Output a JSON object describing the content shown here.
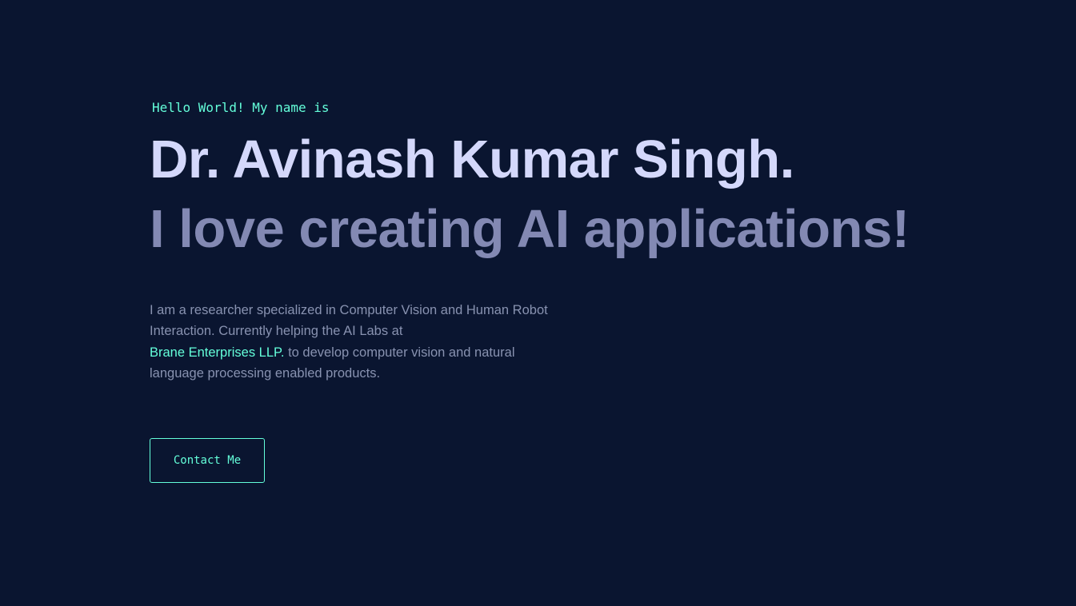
{
  "hero": {
    "greeting": "Hello World! My name is",
    "name": "Dr. Avinash Kumar Singh.",
    "tagline": "I love creating AI applications!",
    "bio": {
      "part1": "I am a researcher specialized in Computer Vision and Human Robot Interaction. Currently helping the AI Labs at",
      "company_link": "Brane Enterprises LLP.",
      "part2": "to develop computer vision and natural language processing enabled products."
    },
    "contact_button": "Contact Me"
  },
  "colors": {
    "background": "#0a1530",
    "accent": "#64ffda",
    "heading": "#d4d8fb",
    "subheading": "#8389b3",
    "body_text": "#8892b0"
  }
}
